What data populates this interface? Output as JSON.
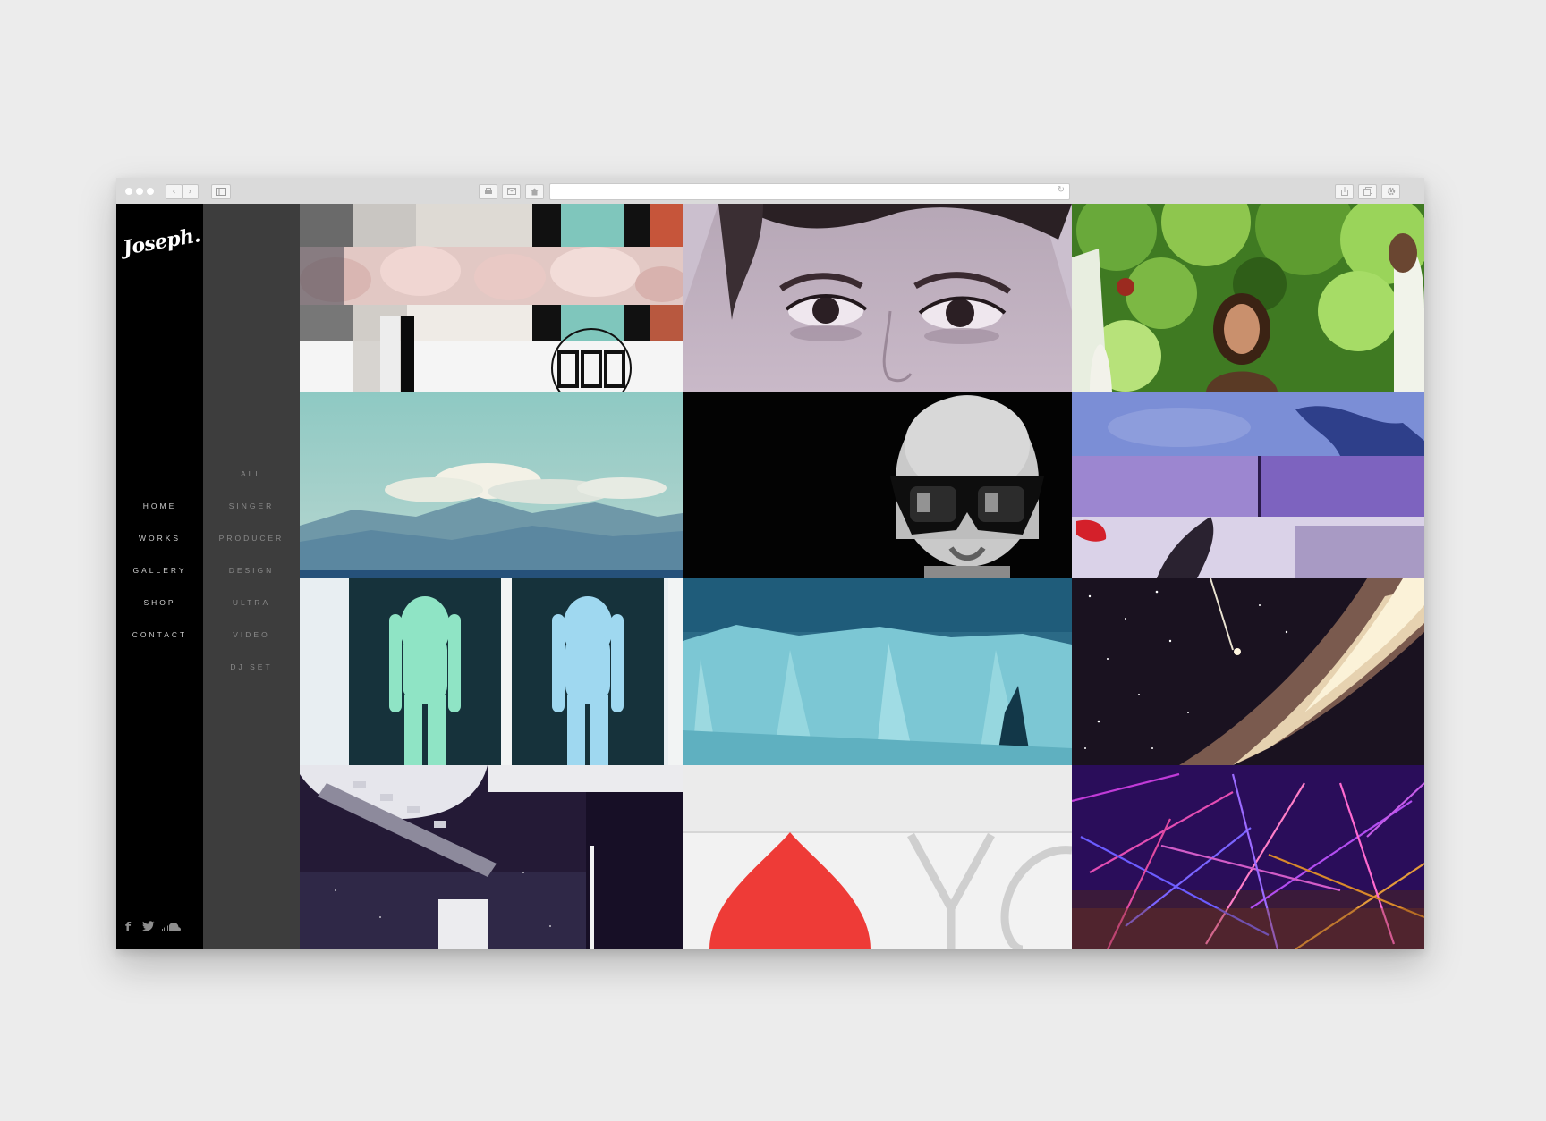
{
  "browser": {
    "nav_back": "‹",
    "nav_forward": "›",
    "reload_icon": "↻"
  },
  "site": {
    "logo": "Joseph.",
    "nav": [
      "HOME",
      "WORKS",
      "GALLERY",
      "SHOP",
      "CONTACT"
    ],
    "filters": [
      "ALL",
      "SINGER",
      "PRODUCER",
      "DESIGN",
      "ULTRA",
      "VIDEO",
      "DJ SET"
    ],
    "social": [
      "f",
      "t",
      "soundcloud"
    ]
  },
  "tiles": [
    {
      "name": "collage-flowers",
      "row": 0,
      "col": 0
    },
    {
      "name": "woman-eyes-closeup",
      "row": 0,
      "col": 1
    },
    {
      "name": "woman-in-forest",
      "row": 0,
      "col": 2
    },
    {
      "name": "clouds-over-mountains",
      "row": 1,
      "col": 0
    },
    {
      "name": "man-with-sunglasses",
      "row": 1,
      "col": 1
    },
    {
      "name": "purple-paint-strips",
      "row": 1,
      "col": 2
    },
    {
      "name": "twin-figures",
      "row": 2,
      "col": 0
    },
    {
      "name": "blue-cliff",
      "row": 2,
      "col": 1
    },
    {
      "name": "galaxy",
      "row": 2,
      "col": 2
    },
    {
      "name": "space-collage",
      "row": 3,
      "col": 0
    },
    {
      "name": "red-shape-typography",
      "row": 3,
      "col": 1
    },
    {
      "name": "neon-grass",
      "row": 3,
      "col": 2
    }
  ],
  "colors": {
    "sidebar_main": "#000000",
    "sidebar_sub": "#3d3d3d",
    "page_bg": "#ececec"
  }
}
